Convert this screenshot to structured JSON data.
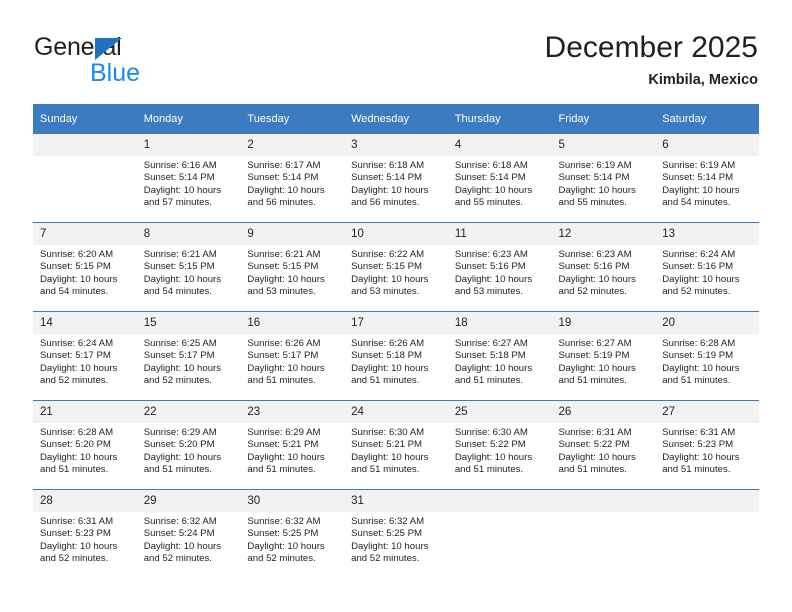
{
  "brand": {
    "word_one": "General",
    "word_two": "Blue",
    "triangle_icon": "brand-triangle-icon",
    "triangle_color": "#1f72bd",
    "blue_color": "#1f87e4"
  },
  "header": {
    "title": "December 2025",
    "subtitle": "Kimbila, Mexico"
  },
  "colors": {
    "header_blue": "#3b7cc1",
    "daynum_bg": "#f2f2f2",
    "text": "#231f20"
  },
  "weekdays": [
    "Sunday",
    "Monday",
    "Tuesday",
    "Wednesday",
    "Thursday",
    "Friday",
    "Saturday"
  ],
  "weeks": [
    [
      {
        "day": "",
        "sunrise": "",
        "sunset": "",
        "daylight": "",
        "blank": true
      },
      {
        "day": "1",
        "sunrise": "Sunrise: 6:16 AM",
        "sunset": "Sunset: 5:14 PM",
        "daylight": "Daylight: 10 hours and 57 minutes."
      },
      {
        "day": "2",
        "sunrise": "Sunrise: 6:17 AM",
        "sunset": "Sunset: 5:14 PM",
        "daylight": "Daylight: 10 hours and 56 minutes."
      },
      {
        "day": "3",
        "sunrise": "Sunrise: 6:18 AM",
        "sunset": "Sunset: 5:14 PM",
        "daylight": "Daylight: 10 hours and 56 minutes."
      },
      {
        "day": "4",
        "sunrise": "Sunrise: 6:18 AM",
        "sunset": "Sunset: 5:14 PM",
        "daylight": "Daylight: 10 hours and 55 minutes."
      },
      {
        "day": "5",
        "sunrise": "Sunrise: 6:19 AM",
        "sunset": "Sunset: 5:14 PM",
        "daylight": "Daylight: 10 hours and 55 minutes."
      },
      {
        "day": "6",
        "sunrise": "Sunrise: 6:19 AM",
        "sunset": "Sunset: 5:14 PM",
        "daylight": "Daylight: 10 hours and 54 minutes."
      }
    ],
    [
      {
        "day": "7",
        "sunrise": "Sunrise: 6:20 AM",
        "sunset": "Sunset: 5:15 PM",
        "daylight": "Daylight: 10 hours and 54 minutes."
      },
      {
        "day": "8",
        "sunrise": "Sunrise: 6:21 AM",
        "sunset": "Sunset: 5:15 PM",
        "daylight": "Daylight: 10 hours and 54 minutes."
      },
      {
        "day": "9",
        "sunrise": "Sunrise: 6:21 AM",
        "sunset": "Sunset: 5:15 PM",
        "daylight": "Daylight: 10 hours and 53 minutes."
      },
      {
        "day": "10",
        "sunrise": "Sunrise: 6:22 AM",
        "sunset": "Sunset: 5:15 PM",
        "daylight": "Daylight: 10 hours and 53 minutes."
      },
      {
        "day": "11",
        "sunrise": "Sunrise: 6:23 AM",
        "sunset": "Sunset: 5:16 PM",
        "daylight": "Daylight: 10 hours and 53 minutes."
      },
      {
        "day": "12",
        "sunrise": "Sunrise: 6:23 AM",
        "sunset": "Sunset: 5:16 PM",
        "daylight": "Daylight: 10 hours and 52 minutes."
      },
      {
        "day": "13",
        "sunrise": "Sunrise: 6:24 AM",
        "sunset": "Sunset: 5:16 PM",
        "daylight": "Daylight: 10 hours and 52 minutes."
      }
    ],
    [
      {
        "day": "14",
        "sunrise": "Sunrise: 6:24 AM",
        "sunset": "Sunset: 5:17 PM",
        "daylight": "Daylight: 10 hours and 52 minutes."
      },
      {
        "day": "15",
        "sunrise": "Sunrise: 6:25 AM",
        "sunset": "Sunset: 5:17 PM",
        "daylight": "Daylight: 10 hours and 52 minutes."
      },
      {
        "day": "16",
        "sunrise": "Sunrise: 6:26 AM",
        "sunset": "Sunset: 5:17 PM",
        "daylight": "Daylight: 10 hours and 51 minutes."
      },
      {
        "day": "17",
        "sunrise": "Sunrise: 6:26 AM",
        "sunset": "Sunset: 5:18 PM",
        "daylight": "Daylight: 10 hours and 51 minutes."
      },
      {
        "day": "18",
        "sunrise": "Sunrise: 6:27 AM",
        "sunset": "Sunset: 5:18 PM",
        "daylight": "Daylight: 10 hours and 51 minutes."
      },
      {
        "day": "19",
        "sunrise": "Sunrise: 6:27 AM",
        "sunset": "Sunset: 5:19 PM",
        "daylight": "Daylight: 10 hours and 51 minutes."
      },
      {
        "day": "20",
        "sunrise": "Sunrise: 6:28 AM",
        "sunset": "Sunset: 5:19 PM",
        "daylight": "Daylight: 10 hours and 51 minutes."
      }
    ],
    [
      {
        "day": "21",
        "sunrise": "Sunrise: 6:28 AM",
        "sunset": "Sunset: 5:20 PM",
        "daylight": "Daylight: 10 hours and 51 minutes."
      },
      {
        "day": "22",
        "sunrise": "Sunrise: 6:29 AM",
        "sunset": "Sunset: 5:20 PM",
        "daylight": "Daylight: 10 hours and 51 minutes."
      },
      {
        "day": "23",
        "sunrise": "Sunrise: 6:29 AM",
        "sunset": "Sunset: 5:21 PM",
        "daylight": "Daylight: 10 hours and 51 minutes."
      },
      {
        "day": "24",
        "sunrise": "Sunrise: 6:30 AM",
        "sunset": "Sunset: 5:21 PM",
        "daylight": "Daylight: 10 hours and 51 minutes."
      },
      {
        "day": "25",
        "sunrise": "Sunrise: 6:30 AM",
        "sunset": "Sunset: 5:22 PM",
        "daylight": "Daylight: 10 hours and 51 minutes."
      },
      {
        "day": "26",
        "sunrise": "Sunrise: 6:31 AM",
        "sunset": "Sunset: 5:22 PM",
        "daylight": "Daylight: 10 hours and 51 minutes."
      },
      {
        "day": "27",
        "sunrise": "Sunrise: 6:31 AM",
        "sunset": "Sunset: 5:23 PM",
        "daylight": "Daylight: 10 hours and 51 minutes."
      }
    ],
    [
      {
        "day": "28",
        "sunrise": "Sunrise: 6:31 AM",
        "sunset": "Sunset: 5:23 PM",
        "daylight": "Daylight: 10 hours and 52 minutes."
      },
      {
        "day": "29",
        "sunrise": "Sunrise: 6:32 AM",
        "sunset": "Sunset: 5:24 PM",
        "daylight": "Daylight: 10 hours and 52 minutes."
      },
      {
        "day": "30",
        "sunrise": "Sunrise: 6:32 AM",
        "sunset": "Sunset: 5:25 PM",
        "daylight": "Daylight: 10 hours and 52 minutes."
      },
      {
        "day": "31",
        "sunrise": "Sunrise: 6:32 AM",
        "sunset": "Sunset: 5:25 PM",
        "daylight": "Daylight: 10 hours and 52 minutes."
      },
      {
        "day": "",
        "sunrise": "",
        "sunset": "",
        "daylight": "",
        "blank": true
      },
      {
        "day": "",
        "sunrise": "",
        "sunset": "",
        "daylight": "",
        "blank": true
      },
      {
        "day": "",
        "sunrise": "",
        "sunset": "",
        "daylight": "",
        "blank": true
      }
    ]
  ]
}
